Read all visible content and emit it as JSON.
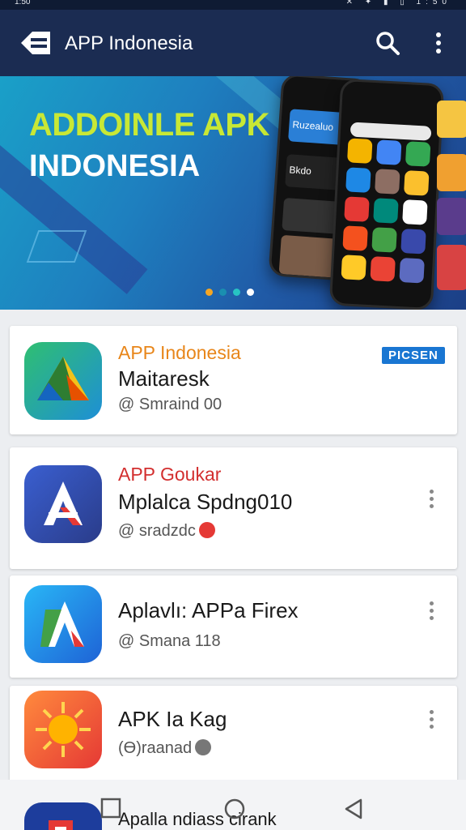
{
  "status_bar": {
    "time": "1:50",
    "icons_text": "✕ ✦ ▮ ▯ 1:50"
  },
  "app_bar": {
    "title": "APP Indonesia"
  },
  "banner": {
    "headline_line1": "ADDOINLE APK",
    "headline_line2": "INDONESIA",
    "phone_card_labels": [
      "Ruzealuo",
      "Bkdo"
    ],
    "carousel_dots": 4,
    "active_dot": 1
  },
  "apps": [
    {
      "title": "APP Indonesia",
      "title_color": "#e8861a",
      "subtitle": "Maitaresk",
      "meta": "@ Smraind 00",
      "badge": "PICSEN"
    },
    {
      "title": "APP Goukar",
      "title_color": "#d32f2f",
      "subtitle": "Mplalca Spdng010",
      "meta": "@ sradzdc"
    },
    {
      "title": "Aplavlı: APPa Firex",
      "meta": "@ Smana 118"
    },
    {
      "title": "APK Ia Kag",
      "meta": "(Ɵ)raanad"
    },
    {
      "title": "Apalla ndiass cirank"
    }
  ],
  "colors": {
    "app_bar": "#1b2c52",
    "accent_blue": "#1976d2",
    "orange": "#e8861a",
    "red": "#d32f2f"
  }
}
